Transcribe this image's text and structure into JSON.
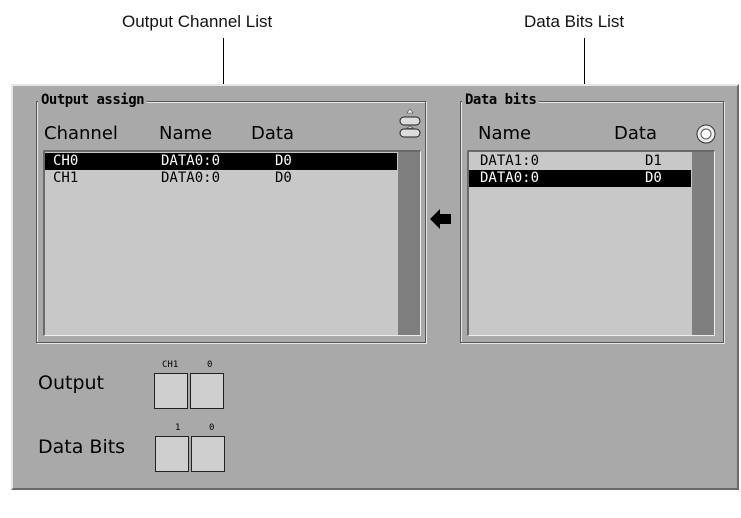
{
  "callouts": {
    "output_channel_list": "Output Channel List",
    "data_bits_list": "Data Bits List"
  },
  "output_assign": {
    "title": "Output assign",
    "headers": {
      "channel": "Channel",
      "name": "Name",
      "data": "Data"
    },
    "rows": [
      {
        "channel": "CH0",
        "name": "DATA0:0",
        "data": "D0",
        "selected": true
      },
      {
        "channel": "CH1",
        "name": "DATA0:0",
        "data": "D0",
        "selected": false
      }
    ]
  },
  "data_bits": {
    "title": "Data bits",
    "headers": {
      "name": "Name",
      "data": "Data"
    },
    "rows": [
      {
        "name": "DATA1:0",
        "data": "D1",
        "selected": false
      },
      {
        "name": "DATA0:0",
        "data": "D0",
        "selected": true
      }
    ]
  },
  "output": {
    "label": "Output",
    "bit_labels": [
      "CH1",
      "0"
    ]
  },
  "data_bits_display": {
    "label": "Data Bits",
    "bit_labels": [
      "1",
      "0"
    ]
  },
  "icons": {
    "assign_arrow": "arrow-left-icon",
    "scroll_stepper": "scroll-stepper-icon",
    "knob": "knob-icon"
  }
}
